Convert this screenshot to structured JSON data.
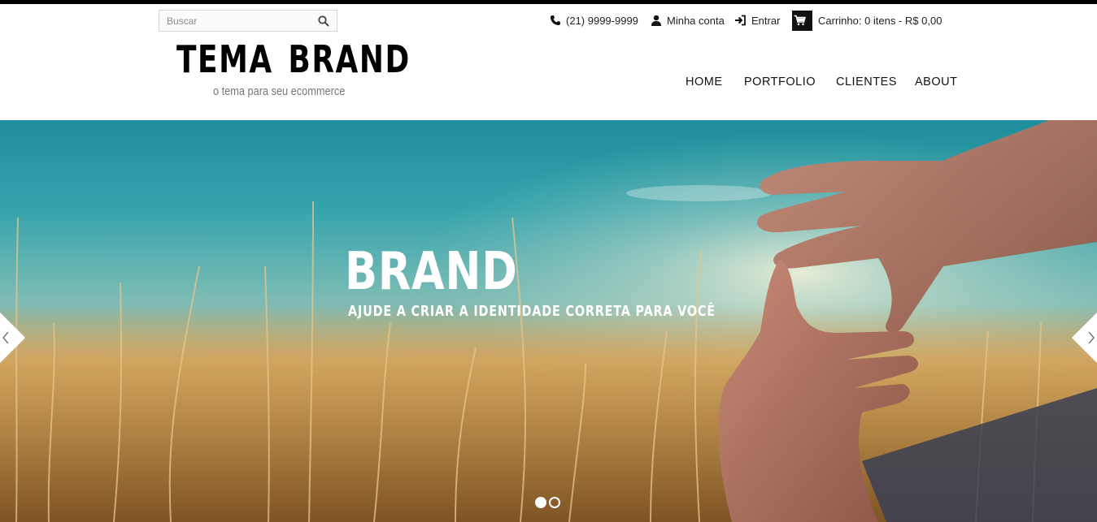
{
  "search": {
    "placeholder": "Buscar",
    "icon": "search-icon"
  },
  "utility": {
    "phone": {
      "icon": "phone-icon",
      "label": "(21) 9999-9999"
    },
    "account": {
      "icon": "user-icon",
      "label": "Minha conta"
    },
    "login": {
      "icon": "sign-in-icon",
      "label": "Entrar"
    },
    "cart": {
      "icon": "cart-icon",
      "label": "Carrinho: 0 itens - R$ 0,00"
    }
  },
  "logo": {
    "title": "TEMA BRAND",
    "tagline": "o tema para seu ecommerce"
  },
  "nav": {
    "items": [
      {
        "label": "HOME"
      },
      {
        "label": "PORTFOLIO"
      },
      {
        "label": "CLIENTES"
      },
      {
        "label": "ABOUT"
      }
    ]
  },
  "hero": {
    "title": "BRAND",
    "subtitle": "AJUDE A CRIAR A IDENTIDADE CORRETA PARA VOCÊ",
    "prev_icon": "chevron-left-icon",
    "next_icon": "chevron-right-icon",
    "slides_total": 2,
    "active_slide": 1
  },
  "colors": {
    "topbar": "#000000",
    "cart_box": "#111111",
    "hero_text": "#ffffff"
  }
}
